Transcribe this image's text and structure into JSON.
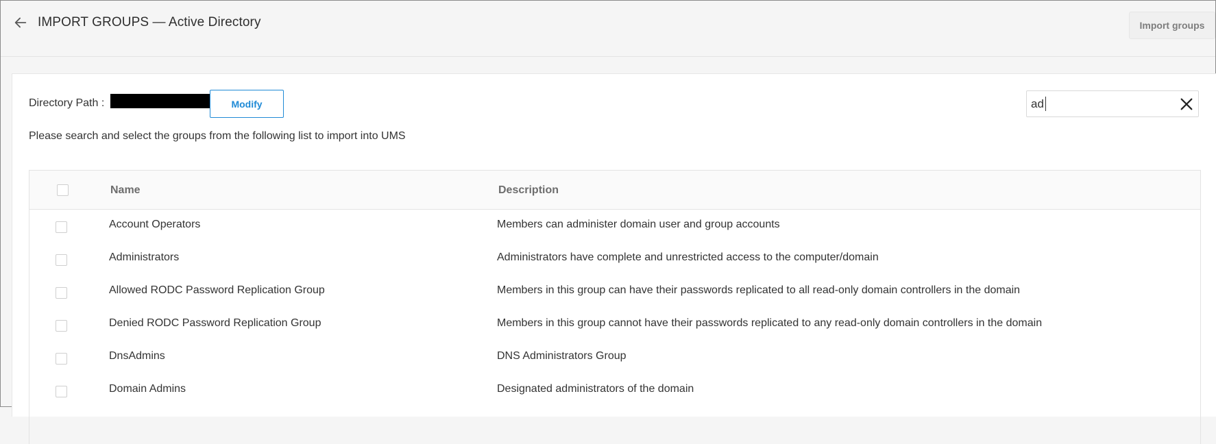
{
  "header": {
    "title": "IMPORT GROUPS — Active Directory",
    "import_button": "Import groups"
  },
  "directory": {
    "label": "Directory Path :",
    "modify_button": "Modify"
  },
  "search": {
    "value": "ad"
  },
  "instructions": "Please search and select the groups from the following list to import into UMS",
  "table": {
    "columns": [
      "Name",
      "Description"
    ],
    "rows": [
      {
        "name": "Account Operators",
        "description": "Members can administer domain user and group accounts"
      },
      {
        "name": "Administrators",
        "description": "Administrators have complete and unrestricted access to the computer/domain"
      },
      {
        "name": "Allowed RODC Password Replication Group",
        "description": "Members in this group can have their passwords replicated to all read-only domain controllers in the domain"
      },
      {
        "name": "Denied RODC Password Replication Group",
        "description": "Members in this group cannot have their passwords replicated to any read-only domain controllers in the domain"
      },
      {
        "name": "DnsAdmins",
        "description": "DNS Administrators Group"
      },
      {
        "name": "Domain Admins",
        "description": "Designated administrators of the domain"
      }
    ]
  },
  "icons": {
    "back": "arrow-left-icon",
    "clear": "close-icon"
  },
  "colors": {
    "accent": "#1f8ad6",
    "redaction": "#000000"
  }
}
